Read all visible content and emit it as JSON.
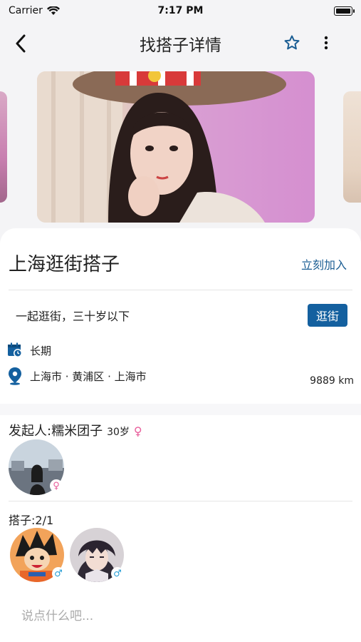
{
  "status_bar": {
    "carrier": "Carrier",
    "time": "7:17 PM"
  },
  "nav": {
    "title": "找搭子详情"
  },
  "activity": {
    "title": "上海逛街搭子",
    "join_label": "立刻加入",
    "description": "一起逛街，三十岁以下",
    "tag": "逛街",
    "duration": "长期",
    "location": "上海市 · 黄浦区 · 上海市",
    "distance": "9889 km"
  },
  "initiator": {
    "label": "发起人:糯米团子",
    "age": "30岁",
    "gender_symbol": "♀"
  },
  "partners": {
    "label": "搭子:2/1",
    "members": [
      {
        "gender_symbol": "♂"
      },
      {
        "gender_symbol": "♂"
      }
    ]
  },
  "comment": {
    "placeholder": "说点什么吧..."
  },
  "colors": {
    "accent": "#1a5d93",
    "tag_bg": "#14609f",
    "female": "#e85c9a",
    "male": "#2a9fd6"
  }
}
